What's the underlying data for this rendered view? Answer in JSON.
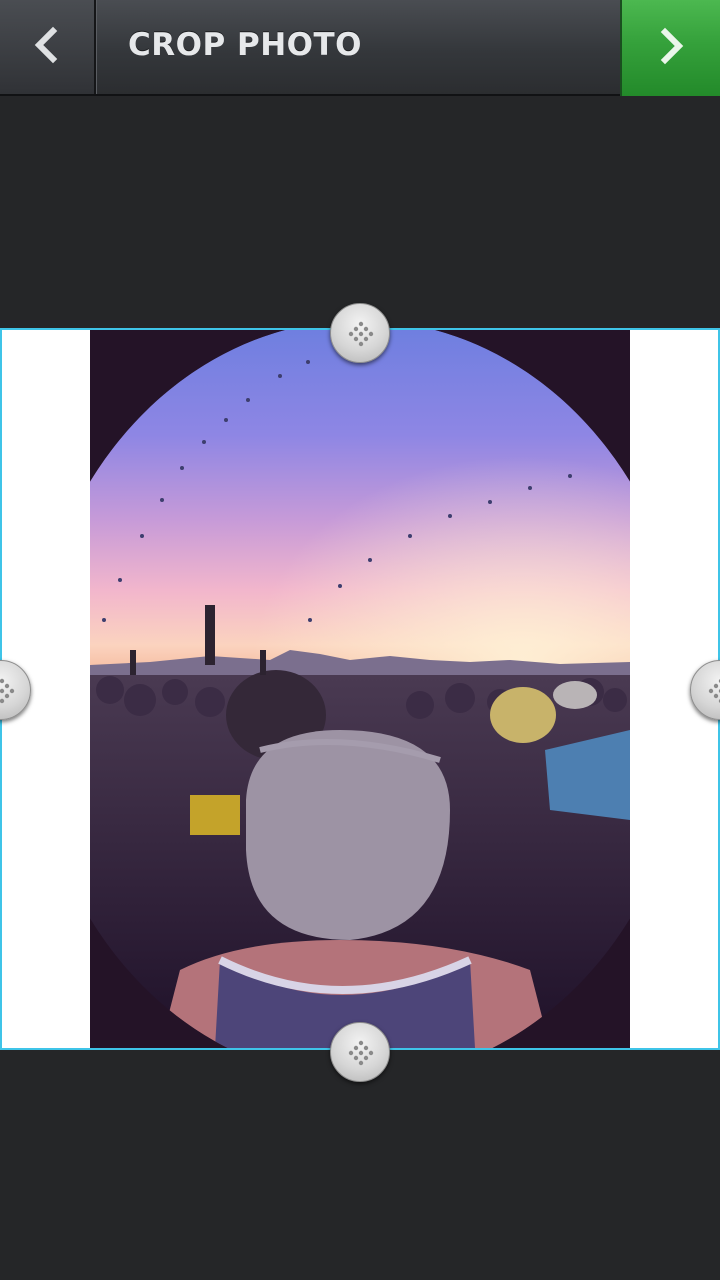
{
  "header": {
    "title": "CROP PHOTO",
    "back_icon": "chevron-left-icon",
    "next_icon": "chevron-right-icon",
    "next_color": "#36a33c"
  },
  "crop": {
    "frame_color": "#3fc4e8",
    "handle_icon": "drag-grip-icon"
  }
}
